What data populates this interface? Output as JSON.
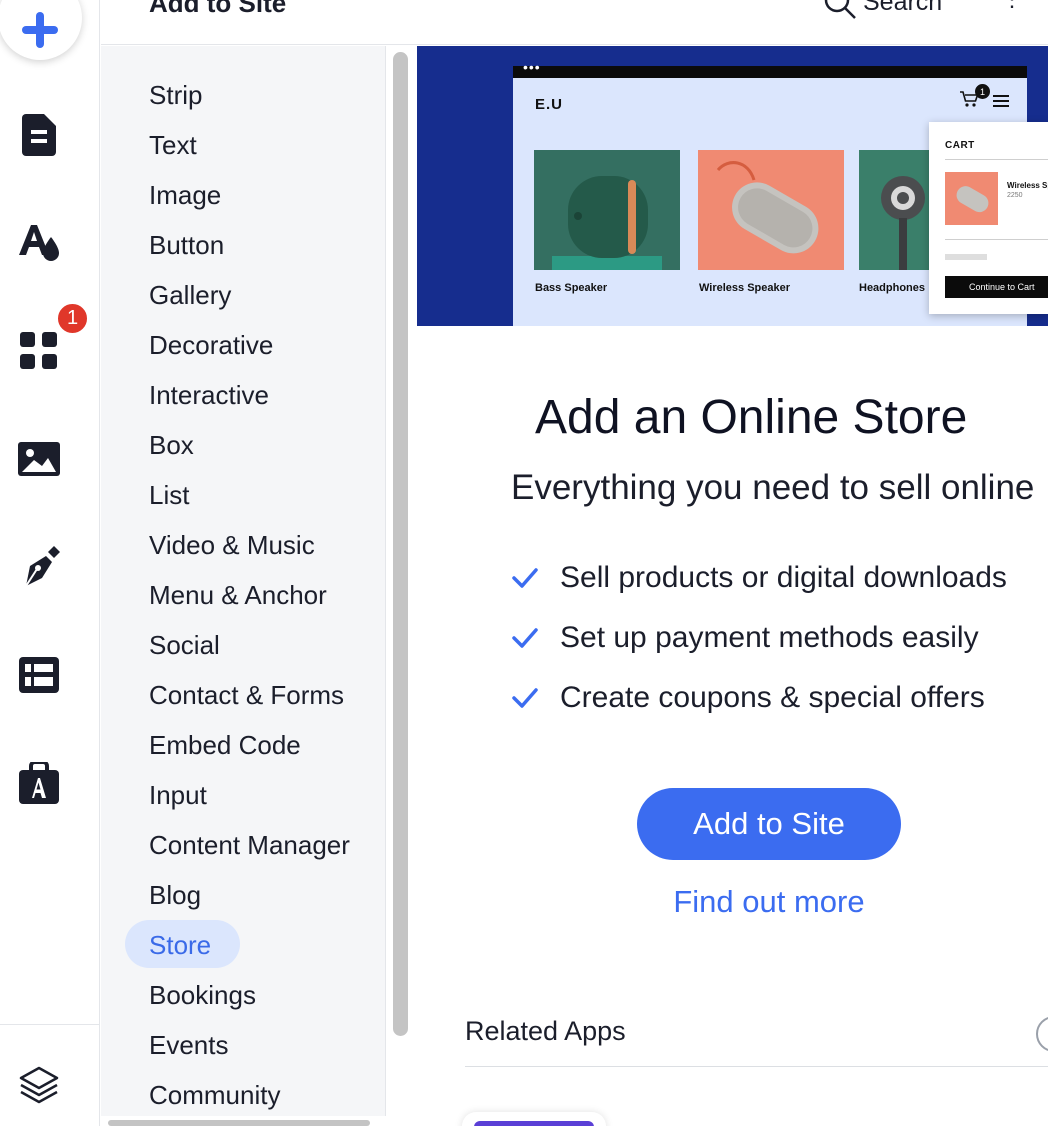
{
  "header": {
    "title": "Add to Site",
    "search_label": "Search",
    "more_label": "⋮"
  },
  "rail": {
    "apps_badge_count": "1",
    "items": [
      "add-elements",
      "pages",
      "theme",
      "apps",
      "media",
      "pen-tool",
      "cms",
      "business"
    ]
  },
  "categories": {
    "selected": "Store",
    "items": [
      "Strip",
      "Text",
      "Image",
      "Button",
      "Gallery",
      "Decorative",
      "Interactive",
      "Box",
      "List",
      "Video & Music",
      "Menu & Anchor",
      "Social",
      "Contact & Forms",
      "Embed Code",
      "Input",
      "Content Manager",
      "Blog",
      "Store",
      "Bookings",
      "Events",
      "Community"
    ]
  },
  "preview": {
    "brand": "E.U",
    "cart_count": "1",
    "products": [
      "Bass Speaker",
      "Wireless Speaker",
      "Headphones"
    ],
    "cart_popup": {
      "title": "CART",
      "item_name": "Wireless Speaker",
      "item_price": "2250",
      "button": "Continue to Cart"
    }
  },
  "content": {
    "title": "Add an Online Store",
    "subtitle": "Everything you need to sell online",
    "features": [
      "Sell products or digital downloads",
      "Set up payment methods easily",
      "Create coupons & special offers"
    ],
    "cta_label": "Add to Site",
    "link_label": "Find out more",
    "related_label": "Related Apps"
  },
  "colors": {
    "accent": "#3b6cf0",
    "banner": "#162d8e",
    "selected_bg": "#dbe6fd",
    "badge": "#e0372a"
  }
}
